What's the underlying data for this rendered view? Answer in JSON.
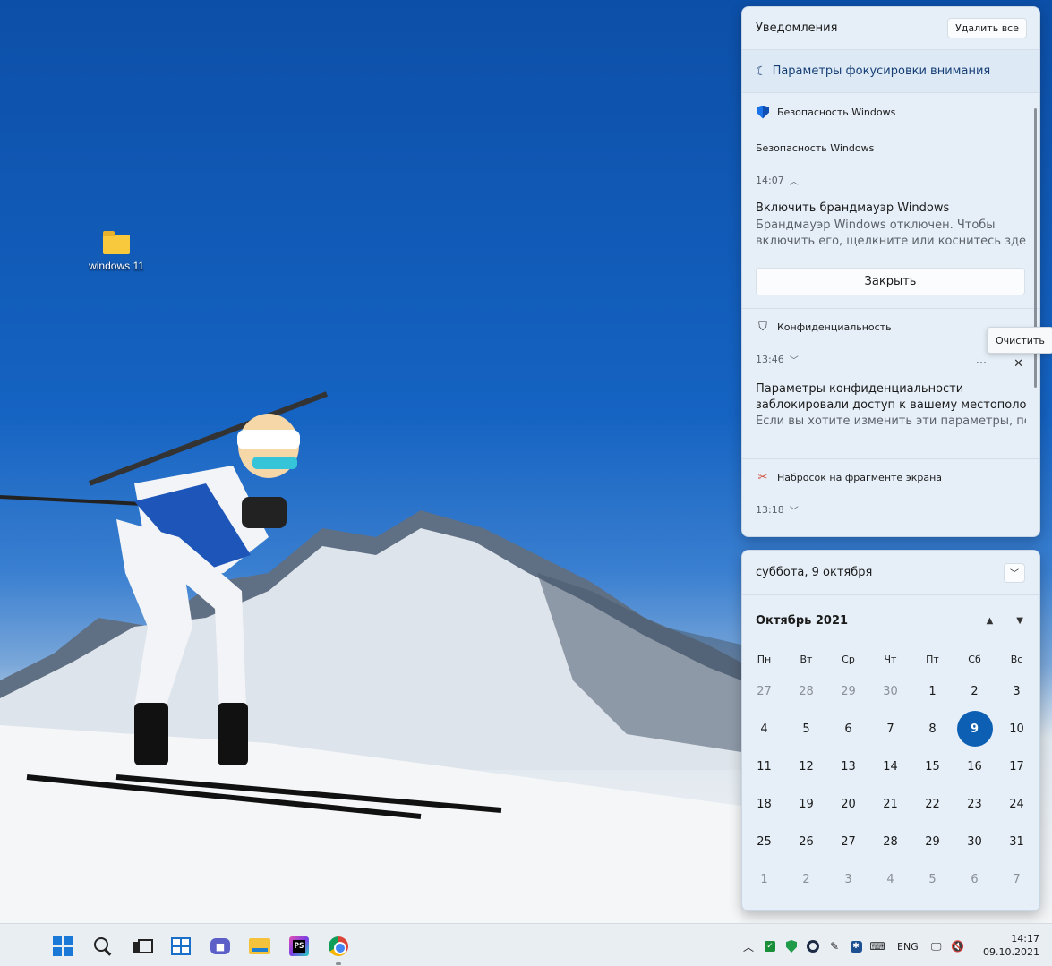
{
  "desktop": {
    "icons": [
      {
        "label": "windows 11",
        "icon": "folder-icon"
      }
    ]
  },
  "notifications": {
    "title": "Уведомления",
    "clear_all": "Удалить все",
    "focus_assist": "Параметры фокусировки внимания",
    "groups": [
      {
        "app": "Безопасность Windows",
        "icon": "windows-security-shield-icon",
        "sub_app": "Безопасность Windows",
        "time": "14:07",
        "heading": "Включить брандмауэр Windows",
        "body_line1": "Брандмауэр Windows отключен. Чтобы",
        "body_line2": "включить его, щелкните или коснитесь здесь.",
        "action": "Закрыть"
      },
      {
        "app": "Конфиденциальность",
        "icon": "privacy-shield-icon",
        "time": "13:46",
        "more": "···",
        "close": "✕",
        "heading_line1": "Параметры конфиденциальности",
        "heading_line2": "заблокировали доступ к вашему местоположе",
        "body": "Если вы хотите изменить эти параметры, перей"
      },
      {
        "app": "Набросок на фрагменте экрана",
        "icon": "snip-sketch-icon",
        "time": "13:18"
      }
    ],
    "tooltip": "Очистить"
  },
  "calendar": {
    "date_header": "суббота, 9 октября",
    "month": "Октябрь 2021",
    "weekdays": [
      "Пн",
      "Вт",
      "Ср",
      "Чт",
      "Пт",
      "Сб",
      "Вс"
    ],
    "days": [
      [
        "27",
        "28",
        "29",
        "30",
        "1",
        "2",
        "3"
      ],
      [
        "4",
        "5",
        "6",
        "7",
        "8",
        "9",
        "10"
      ],
      [
        "11",
        "12",
        "13",
        "14",
        "15",
        "16",
        "17"
      ],
      [
        "18",
        "19",
        "20",
        "21",
        "22",
        "23",
        "24"
      ],
      [
        "25",
        "26",
        "27",
        "28",
        "29",
        "30",
        "31"
      ],
      [
        "1",
        "2",
        "3",
        "4",
        "5",
        "6",
        "7"
      ]
    ],
    "today": "9",
    "accent": "#0d5fb3"
  },
  "taskbar": {
    "apps": [
      "start-icon",
      "search-icon",
      "task-view-icon",
      "widgets-icon",
      "teams-chat-icon",
      "file-explorer-icon",
      "phpstorm-icon",
      "chrome-icon"
    ],
    "tray": {
      "language": "ENG"
    },
    "clock": {
      "time": "14:17",
      "date": "09.10.2021"
    }
  }
}
